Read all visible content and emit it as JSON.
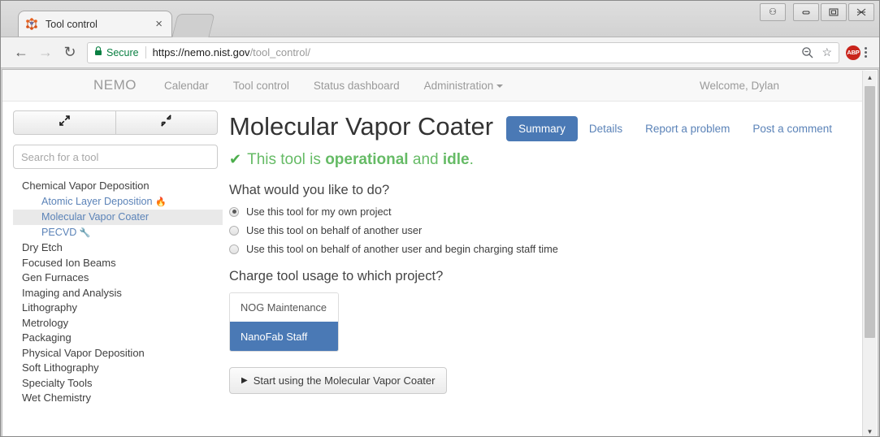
{
  "browser": {
    "tab": {
      "title": "Tool control",
      "favicon": "molecule-icon",
      "close": "×"
    },
    "window_controls": {
      "user": "⚇",
      "minimize": "—",
      "maximize": "▣",
      "close": "✕"
    },
    "nav": {
      "back": "←",
      "forward": "→",
      "reload": "↻"
    },
    "omnibox": {
      "lock": "🔒",
      "secure_label": "Secure",
      "url_host": "https://nemo.nist.gov",
      "url_path": "/tool_control/",
      "zoom_icon": "⊖",
      "bookmark_icon": "☆",
      "extension": "ABP"
    }
  },
  "site_nav": {
    "brand": "NEMO",
    "items": [
      {
        "label": "Calendar"
      },
      {
        "label": "Tool control"
      },
      {
        "label": "Status dashboard"
      },
      {
        "label": "Administration",
        "has_caret": true
      }
    ],
    "welcome": "Welcome, Dylan"
  },
  "sidebar": {
    "expand_all_icon": "expand-arrows-icon",
    "collapse_all_icon": "collapse-arrows-icon",
    "search": {
      "placeholder": "Search for a tool",
      "value": ""
    },
    "tree": [
      {
        "type": "category",
        "label": "Chemical Vapor Deposition"
      },
      {
        "type": "tool",
        "label": "Atomic Layer Deposition",
        "badge": "🔥",
        "selected": false
      },
      {
        "type": "tool",
        "label": "Molecular Vapor Coater",
        "badge": "",
        "selected": true
      },
      {
        "type": "tool",
        "label": "PECVD",
        "badge": "🔧",
        "selected": false
      },
      {
        "type": "category",
        "label": "Dry Etch"
      },
      {
        "type": "category",
        "label": "Focused Ion Beams"
      },
      {
        "type": "category",
        "label": "Gen Furnaces"
      },
      {
        "type": "category",
        "label": "Imaging and Analysis"
      },
      {
        "type": "category",
        "label": "Lithography"
      },
      {
        "type": "category",
        "label": "Metrology"
      },
      {
        "type": "category",
        "label": "Packaging"
      },
      {
        "type": "category",
        "label": "Physical Vapor Deposition"
      },
      {
        "type": "category",
        "label": "Soft Lithography"
      },
      {
        "type": "category",
        "label": "Specialty Tools"
      },
      {
        "type": "category",
        "label": "Wet Chemistry"
      }
    ]
  },
  "main": {
    "title": "Molecular Vapor Coater",
    "tabs": [
      {
        "label": "Summary",
        "active": true
      },
      {
        "label": "Details",
        "active": false
      },
      {
        "label": "Report a problem",
        "active": false
      },
      {
        "label": "Post a comment",
        "active": false
      }
    ],
    "status": {
      "check_icon": "✔",
      "prefix": "This tool is ",
      "state": "operational",
      "middle": " and ",
      "activity": "idle",
      "suffix": "."
    },
    "question": "What would you like to do?",
    "options": [
      {
        "label": "Use this tool for my own project",
        "checked": true
      },
      {
        "label": "Use this tool on behalf of another user",
        "checked": false
      },
      {
        "label": "Use this tool on behalf of another user and begin charging staff time",
        "checked": false
      }
    ],
    "project_question": "Charge tool usage to which project?",
    "projects": [
      {
        "label": "NOG Maintenance",
        "selected": false
      },
      {
        "label": "NanoFab Staff",
        "selected": true
      }
    ],
    "start_button": {
      "icon": "▶",
      "label": "Start using the Molecular Vapor Coater"
    }
  },
  "scrollbar": {
    "up": "▲",
    "down": "▼"
  },
  "colors": {
    "accent_blue": "#4a79b5",
    "link_blue": "#5b83b8",
    "success_green": "#66bb66",
    "secure_green": "#0b8043"
  }
}
